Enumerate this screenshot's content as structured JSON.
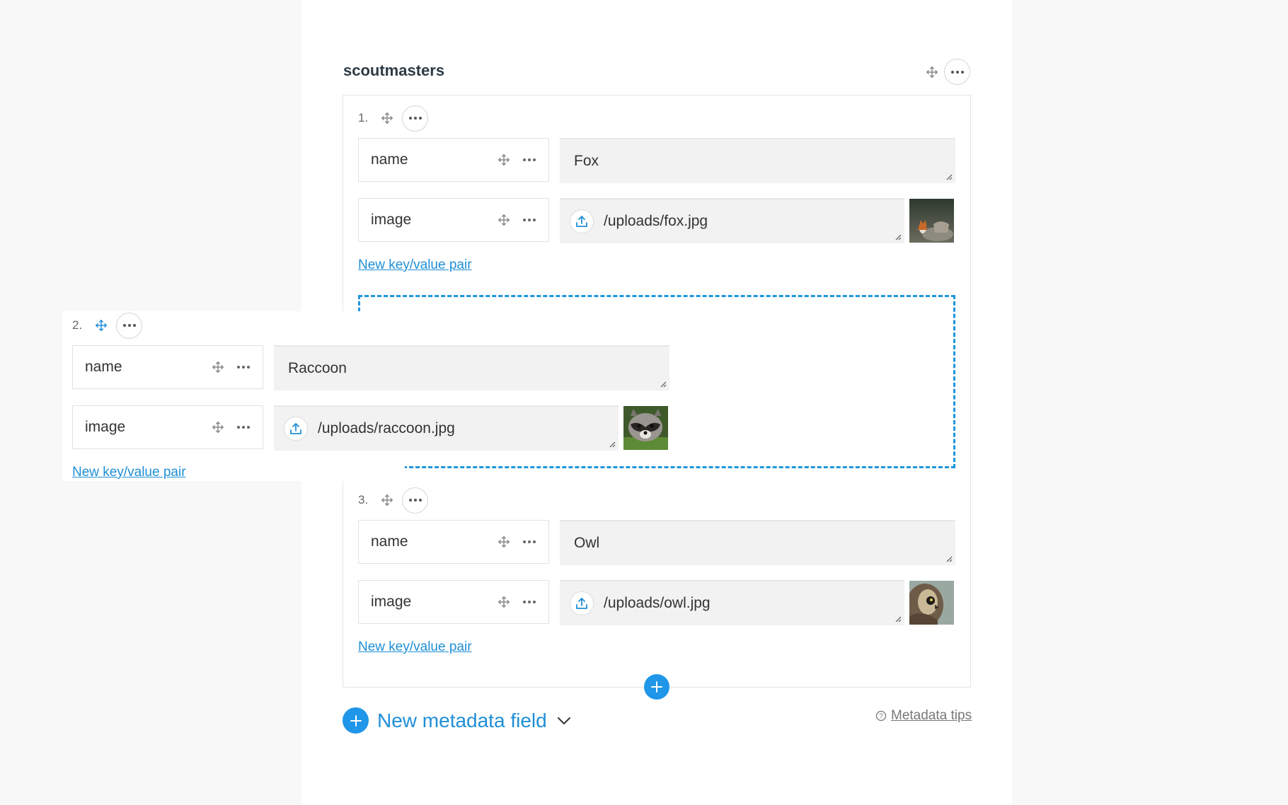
{
  "section": {
    "title": "scoutmasters"
  },
  "items": [
    {
      "number": "1.",
      "name_key": "name",
      "name_value": "Fox",
      "image_key": "image",
      "image_value": "/uploads/fox.jpg",
      "thumb_icon": "fox-thumbnail",
      "new_pair_label": "New key/value pair"
    },
    {
      "number": "2.",
      "name_key": "name",
      "name_value": "Raccoon",
      "image_key": "image",
      "image_value": "/uploads/raccoon.jpg",
      "thumb_icon": "raccoon-thumbnail",
      "new_pair_label": "New key/value pair"
    },
    {
      "number": "3.",
      "name_key": "name",
      "name_value": "Owl",
      "image_key": "image",
      "image_value": "/uploads/owl.jpg",
      "thumb_icon": "owl-thumbnail",
      "new_pair_label": "New key/value pair"
    }
  ],
  "footer": {
    "new_field_label": "New metadata field",
    "tips_label": "Metadata tips"
  },
  "colors": {
    "accent": "#1f96e8",
    "link": "#1f8fd6",
    "field_bg": "#f2f2f2"
  }
}
